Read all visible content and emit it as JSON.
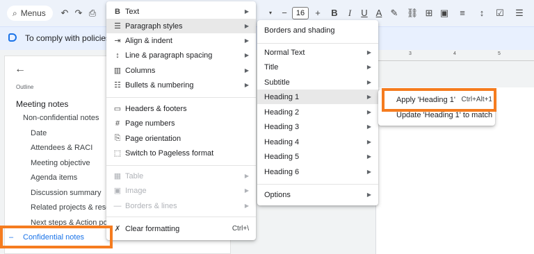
{
  "toolbar": {
    "menus_label": "Menus",
    "font_size": "16",
    "icons": [
      "search-icon",
      "undo-icon",
      "redo-icon",
      "print-icon",
      "minus-icon",
      "plus-icon",
      "bold-icon",
      "italic-icon",
      "underline-icon",
      "text-color-icon",
      "highlight-icon",
      "link-icon",
      "comment-icon",
      "image-icon",
      "align-icon",
      "line-spacing-icon",
      "checklist-icon",
      "bullets-icon"
    ]
  },
  "banner": {
    "text": "To comply with policies, fill"
  },
  "ruler": {
    "labels": [
      "3",
      "4",
      "5"
    ]
  },
  "outline": {
    "label": "Outline",
    "items": [
      {
        "text": "Meeting notes"
      },
      {
        "text": "Non-confidential notes"
      },
      {
        "text": "Date"
      },
      {
        "text": "Attendees & RACI"
      },
      {
        "text": "Meeting objective"
      },
      {
        "text": "Agenda items"
      },
      {
        "text": "Discussion summary"
      },
      {
        "text": "Related projects & resour"
      },
      {
        "text": "Next steps & Action point"
      },
      {
        "text": "Confidential notes",
        "dash": "–"
      }
    ]
  },
  "format_menu": {
    "items": [
      {
        "icon": "B",
        "label": "Text"
      },
      {
        "icon": "☰",
        "label": "Paragraph styles"
      },
      {
        "icon": "⇥",
        "label": "Align & indent"
      },
      {
        "icon": "↕",
        "label": "Line & paragraph spacing"
      },
      {
        "icon": "▥",
        "label": "Columns"
      },
      {
        "icon": "☷",
        "label": "Bullets & numbering"
      },
      {
        "icon": "▭",
        "label": "Headers & footers"
      },
      {
        "icon": "#",
        "label": "Page numbers"
      },
      {
        "icon": "⎘",
        "label": "Page orientation"
      },
      {
        "icon": "⬚",
        "label": "Switch to Pageless format"
      },
      {
        "icon": "▦",
        "label": "Table"
      },
      {
        "icon": "▣",
        "label": "Image"
      },
      {
        "icon": "—",
        "label": "Borders & lines"
      },
      {
        "icon": "✗",
        "label": "Clear formatting",
        "shortcut": "Ctrl+\\"
      }
    ]
  },
  "paragraph_menu": {
    "items": [
      {
        "label": "Borders and shading"
      },
      {
        "label": "Normal Text"
      },
      {
        "label": "Title"
      },
      {
        "label": "Subtitle"
      },
      {
        "label": "Heading 1"
      },
      {
        "label": "Heading 2"
      },
      {
        "label": "Heading 3"
      },
      {
        "label": "Heading 4"
      },
      {
        "label": "Heading 5"
      },
      {
        "label": "Heading 6"
      },
      {
        "label": "Options"
      }
    ]
  },
  "heading_menu": {
    "apply_label": "Apply 'Heading 1'",
    "apply_shortcut": "Ctrl+Alt+1",
    "update_label": "Update 'Heading 1' to match"
  },
  "colors": {
    "highlight": "#f57c1f",
    "accent": "#1a73e8",
    "toolbar_bg": "#edf2fa",
    "banner_bg": "#e8f0fe"
  }
}
